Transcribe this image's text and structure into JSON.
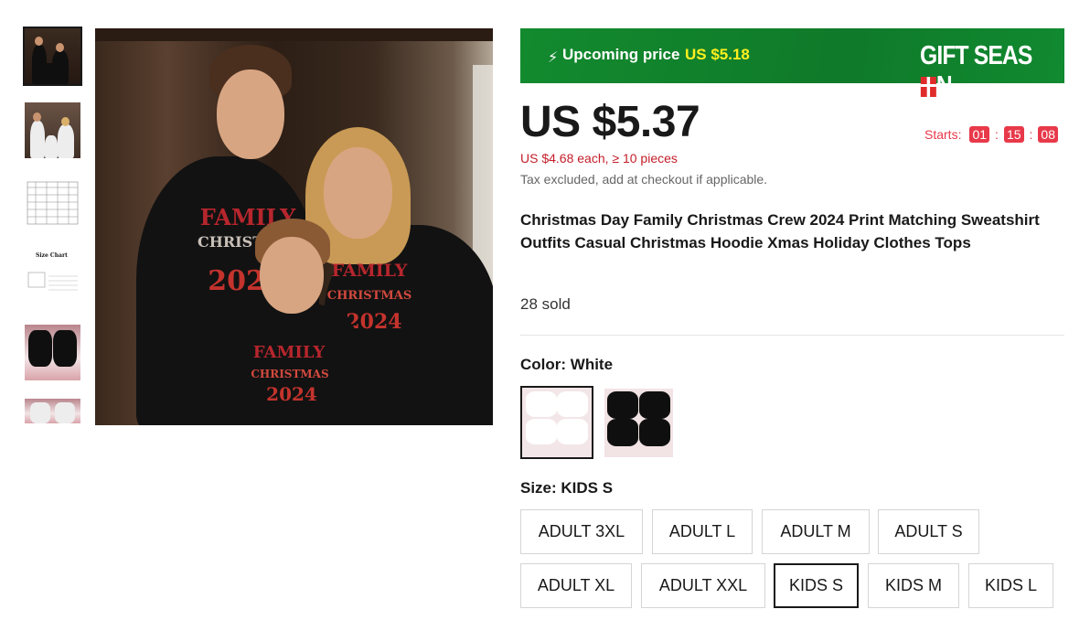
{
  "promo": {
    "label": "Upcoming price",
    "price": "US $5.18",
    "banner_text": "GIFT SEAS",
    "banner_tail": "N"
  },
  "price": {
    "current": "US $5.37",
    "bulk": "US $4.68 each, ≥ 10 pieces",
    "tax": "Tax excluded, add at checkout if applicable."
  },
  "countdown": {
    "label": "Starts:",
    "hours": "01",
    "minutes": "15",
    "seconds": "08",
    "sep": ":"
  },
  "product": {
    "title": "Christmas Day Family Christmas Crew 2024 Print Matching Sweatshirt Outfits Casual Christmas Hoodie Xmas Holiday Clothes Tops",
    "sold": "28 sold"
  },
  "color": {
    "label": "Color: ",
    "selected": "White"
  },
  "size": {
    "label": "Size: ",
    "selected": "KIDS S",
    "options": [
      "ADULT 3XL",
      "ADULT L",
      "ADULT M",
      "ADULT S",
      "ADULT XL",
      "ADULT XXL",
      "KIDS S",
      "KIDS M",
      "KIDS L"
    ]
  },
  "image_text": {
    "family": "FAMILY",
    "christmas": "CHRISTMAS",
    "year": "2024",
    "size_chart": "Size Chart"
  },
  "colors": {
    "promo_green": "#0f7a2a",
    "promo_yellow": "#ffef1f",
    "countdown_red": "#e8394a",
    "bulk_red": "#c41e2a"
  }
}
